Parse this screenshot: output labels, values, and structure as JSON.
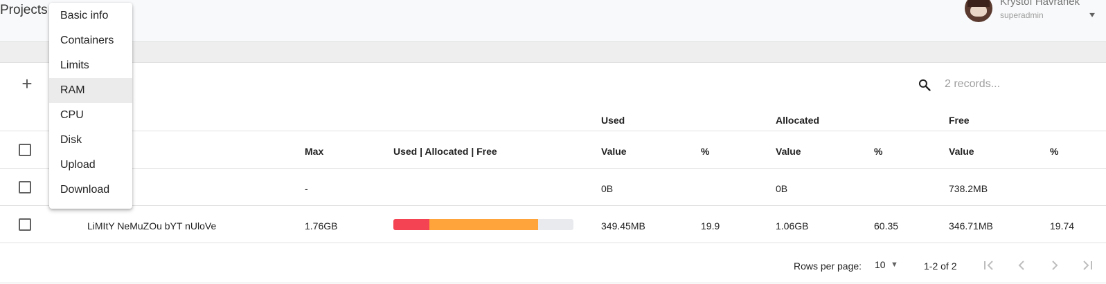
{
  "header": {
    "title": "Projects",
    "user_name": "Krystof Havranek",
    "user_role": "superadmin"
  },
  "toolbar": {
    "add_icon": "plus-icon",
    "search_icon": "magnifier-icon",
    "search_placeholder": "2 records..."
  },
  "table": {
    "group_headers": {
      "used": "Used",
      "allocated": "Allocated",
      "free": "Free"
    },
    "columns": {
      "max": "Max",
      "bar": "Used | Allocated | Free",
      "used_value": "Value",
      "used_pct": "%",
      "allocated_value": "Value",
      "allocated_pct": "%",
      "free_value": "Value",
      "free_pct": "%"
    },
    "rows": [
      {
        "name": "",
        "max": "-",
        "used_fraction": 0,
        "allocated_fraction": 0,
        "used_value": "0B",
        "used_pct": "",
        "allocated_value": "0B",
        "allocated_pct": "",
        "free_value": "738.2MB",
        "free_pct": ""
      },
      {
        "name": "LiMItY NeMuZOu bYT nUloVe",
        "max": "1.76GB",
        "used_fraction": 0.199,
        "allocated_fraction": 0.6035,
        "used_value": "349.45MB",
        "used_pct": "19.9",
        "allocated_value": "1.06GB",
        "allocated_pct": "60.35",
        "free_value": "346.71MB",
        "free_pct": "19.74"
      }
    ]
  },
  "colors": {
    "used": "#f44352",
    "allocated": "#ffa43a",
    "free": "#e8eaed"
  },
  "pagination": {
    "rows_per_page_label": "Rows per page:",
    "rows_per_page_value": "10",
    "range": "1-2 of 2"
  },
  "menu": {
    "items": [
      "Basic info",
      "Containers",
      "Limits",
      "RAM",
      "CPU",
      "Disk",
      "Upload",
      "Download"
    ],
    "active_index": 3
  }
}
